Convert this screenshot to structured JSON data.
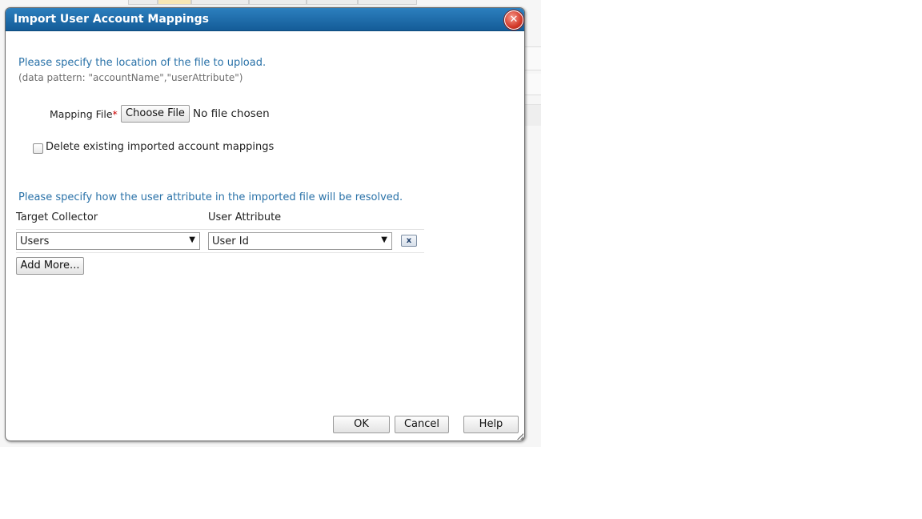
{
  "dialog": {
    "title": "Import User Account Mappings",
    "close_icon": "close-icon"
  },
  "file_section": {
    "instruction": "Please specify the location of the file to upload.",
    "pattern": "(data pattern: \"accountName\",\"userAttribute\")",
    "mapping_label": "Mapping File",
    "required_marker": "*",
    "colon": ":",
    "choose_file_label": "Choose File",
    "file_status": "No file chosen",
    "delete_checkbox_label": "Delete existing imported account mappings",
    "delete_checked": false
  },
  "resolve_section": {
    "instruction": "Please specify how the user attribute in the imported file will be resolved.",
    "columns": [
      "Target Collector",
      "User Attribute"
    ],
    "rows": [
      {
        "target_collector": "Users",
        "user_attribute": "User Id",
        "remove_label": "x"
      }
    ],
    "add_more_label": "Add More..."
  },
  "footer": {
    "ok_label": "OK",
    "cancel_label": "Cancel",
    "help_label": "Help"
  },
  "colors": {
    "titlebar": "#1b6aa8",
    "instruction_text": "#2a72a8",
    "required": "#cc0000"
  }
}
